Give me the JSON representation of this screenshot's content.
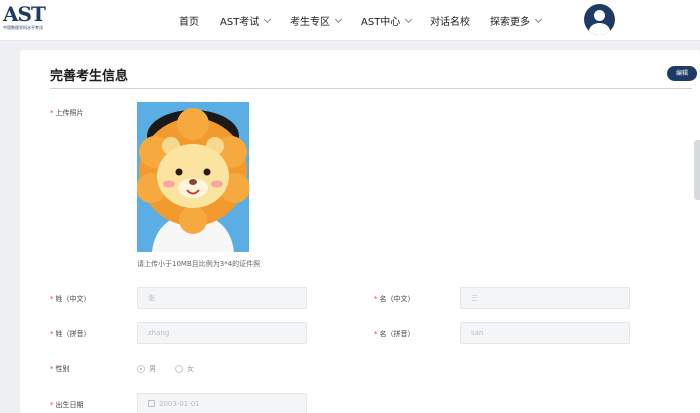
{
  "logo": {
    "mark": "AST",
    "subtitle": "中国数理学科水平考试"
  },
  "nav": {
    "items": [
      {
        "label": "首页",
        "has_menu": false
      },
      {
        "label": "AST考试",
        "has_menu": true
      },
      {
        "label": "考生专区",
        "has_menu": true
      },
      {
        "label": "AST中心",
        "has_menu": true
      },
      {
        "label": "对话名校",
        "has_menu": false
      },
      {
        "label": "探索更多",
        "has_menu": true
      }
    ],
    "avatar_icon": "user-avatar-icon"
  },
  "page": {
    "title": "完善考生信息",
    "edit_label": "编辑"
  },
  "photo": {
    "label": "上传照片",
    "hint": "请上传小于10MB且比例为3*4的证件照"
  },
  "form": {
    "surname_cn": {
      "label": "姓（中文）",
      "value": "张"
    },
    "given_cn": {
      "label": "名（中文）",
      "value": "三"
    },
    "surname_py": {
      "label": "姓（拼音）",
      "value": "zhang"
    },
    "given_py": {
      "label": "名（拼音）",
      "value": "san"
    },
    "gender": {
      "label": "性别",
      "options": [
        "男",
        "女"
      ],
      "selected": "男"
    },
    "birthday": {
      "label": "出生日期",
      "value": "2003-01-01"
    }
  },
  "colors": {
    "brand": "#1f3a64",
    "required": "#e0453a",
    "photo_bg": "#5aaee3"
  }
}
